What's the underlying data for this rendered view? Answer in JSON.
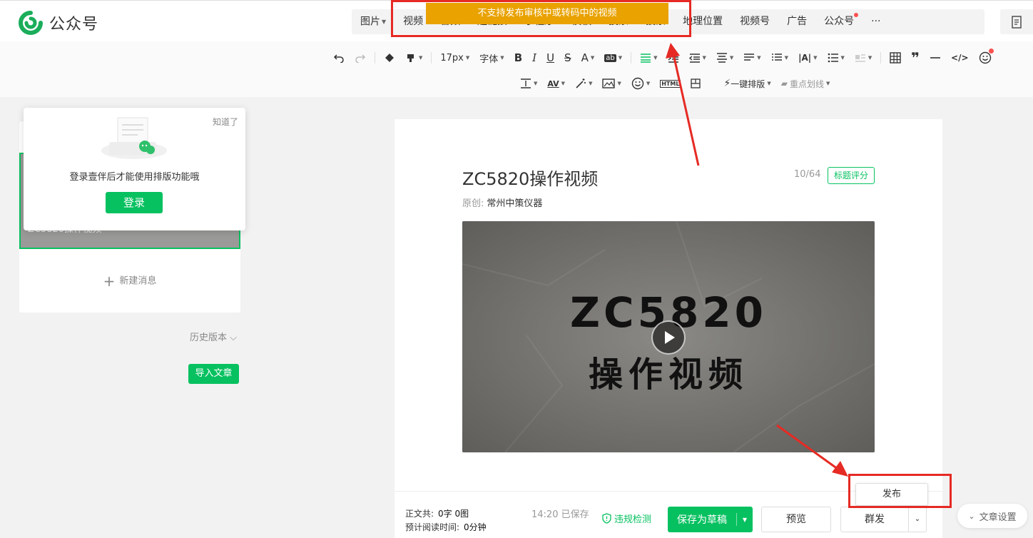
{
  "app": {
    "name": "公众号"
  },
  "menu": [
    {
      "label": "图片",
      "caret": true
    },
    {
      "label": "视频",
      "caret": false
    },
    {
      "label": "音频",
      "caret": false
    },
    {
      "label": "超链接",
      "caret": false
    },
    {
      "label": "小程序",
      "caret": false
    },
    {
      "label": "模板",
      "caret": false
    },
    {
      "label": "投票",
      "caret": false
    },
    {
      "label": "搜索",
      "caret": false
    },
    {
      "label": "地理位置",
      "caret": false
    },
    {
      "label": "视频号",
      "caret": false
    },
    {
      "label": "广告",
      "caret": false
    },
    {
      "label": "公众号",
      "caret": false,
      "dot": true
    },
    {
      "label": "···",
      "caret": false
    }
  ],
  "notice": "不支持发布审核中或转码中的视频",
  "toolbar": {
    "font_size": "17px",
    "font_family": "字体",
    "one_click": "一键排版",
    "key_line": "重点划线"
  },
  "left": {
    "cover_title": "ZC5820操作视频",
    "new_message": "新建消息",
    "history": "历史版本",
    "import": "导入文章"
  },
  "popup": {
    "dismiss": "知道了",
    "message": "登录壹伴后才能使用排版功能哦",
    "login": "登录"
  },
  "article": {
    "title": "ZC5820操作视频",
    "counter": "10/64",
    "score_button": "标题评分",
    "original_label": "原创:",
    "author": "常州中策仪器",
    "video_line1": "ZC5820",
    "video_line2": "操作视频"
  },
  "bottom": {
    "word_label": "正文共:",
    "word_value": "0字 0图",
    "read_label": "预计阅读时间:",
    "read_value": "0分钟",
    "saved": "14:20  已保存",
    "check": "违规检测",
    "save_draft": "保存为草稿",
    "preview": "预览",
    "mass_send": "群发",
    "publish": "发布",
    "article_settings": "文章设置"
  },
  "colors": {
    "brand": "#07c160",
    "notice": "#e9a200",
    "highlight": "#e62a24"
  }
}
